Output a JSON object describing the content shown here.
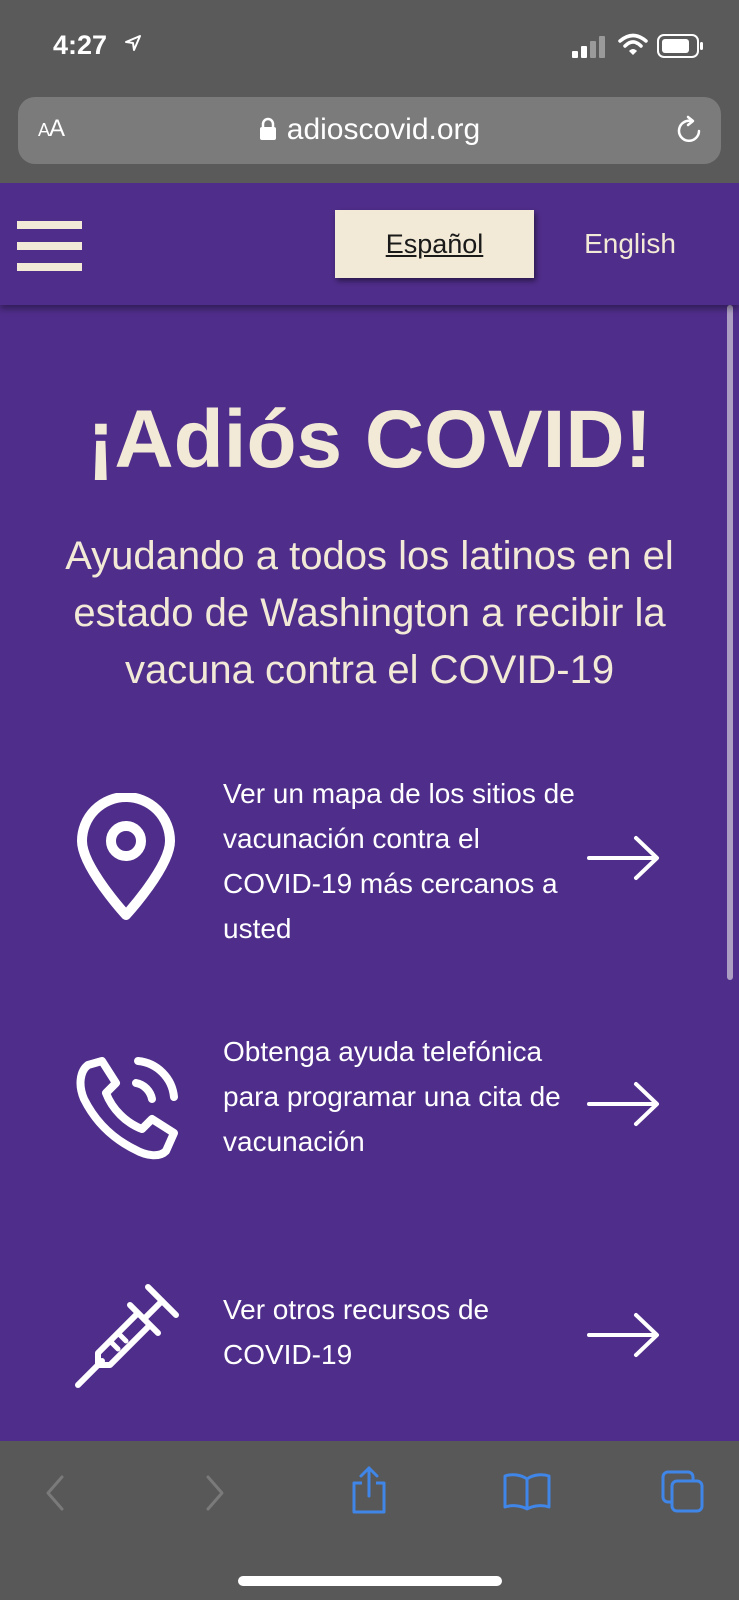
{
  "status_bar": {
    "time": "4:27"
  },
  "browser": {
    "aa_label_small": "A",
    "aa_label_large": "A",
    "url": "adioscovid.org"
  },
  "header": {
    "lang_spanish": "Español",
    "lang_english": "English"
  },
  "hero": {
    "title": "¡Adiós COVID!",
    "subtitle": "Ayudando a todos los latinos en el estado de Washington a recibir la vacuna contra el COVID-19"
  },
  "resources": [
    {
      "text": "Ver un mapa de los sitios de vacunación contra el COVID-19 más cercanos a usted",
      "icon": "map-pin-icon"
    },
    {
      "text": "Obtenga ayuda telefónica para programar una cita de vacunación",
      "icon": "phone-icon"
    },
    {
      "text": "Ver otros recursos de COVID-19",
      "icon": "syringe-icon"
    }
  ],
  "colors": {
    "brand_purple": "#4f2d8a",
    "cream": "#f2ead6",
    "toolbar_blue": "#3f86e8"
  }
}
